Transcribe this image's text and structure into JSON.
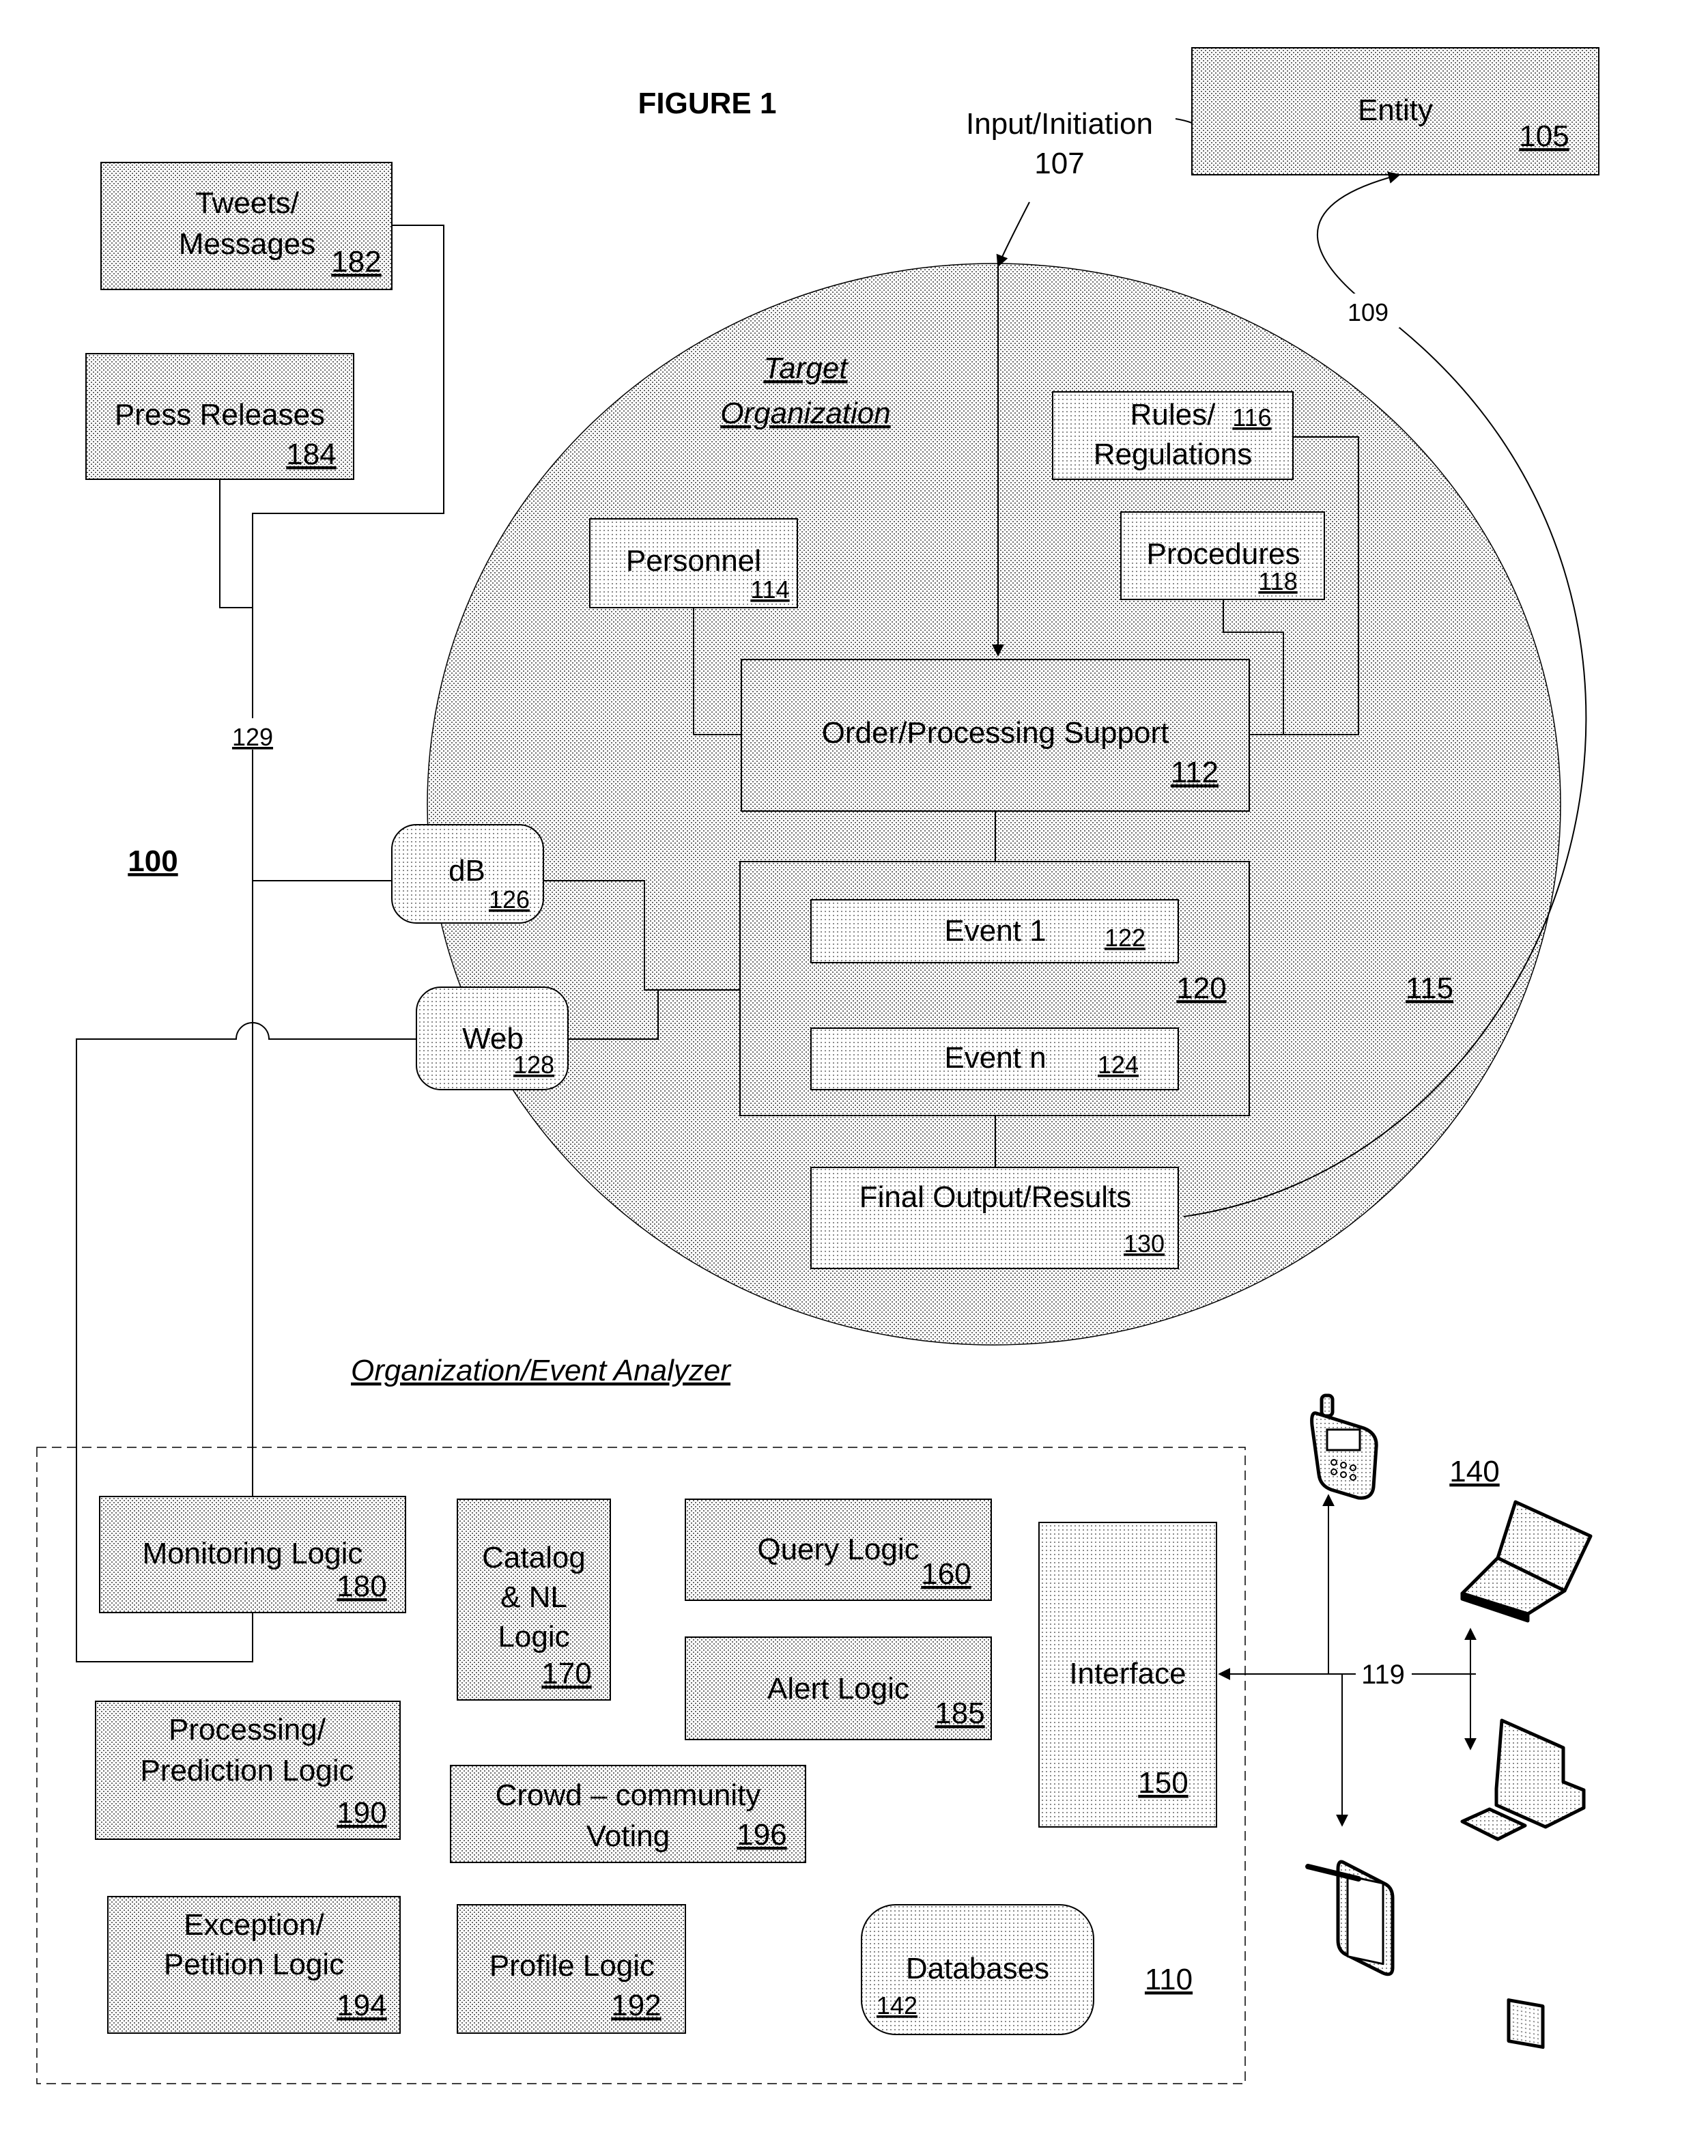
{
  "figure": {
    "title": "FIGURE 1",
    "system_ref": "100"
  },
  "entity": {
    "label": "Entity",
    "ref": "105"
  },
  "input": {
    "label": "Input/Initiation",
    "ref": "107"
  },
  "feedback": {
    "ref": "109"
  },
  "target_org": {
    "title_line1": "Target",
    "title_line2": "Organization",
    "ref": "115",
    "personnel": {
      "label": "Personnel",
      "ref": "114"
    },
    "rules": {
      "label_line1": "Rules/",
      "label_line2": "Regulations",
      "ref": "116"
    },
    "procedures": {
      "label": "Procedures",
      "ref": "118"
    },
    "order_processing": {
      "label": "Order/Processing Support",
      "ref": "112"
    },
    "events_group": {
      "ref": "120"
    },
    "event1": {
      "label": "Event 1",
      "ref": "122"
    },
    "eventn": {
      "label": "Event n",
      "ref": "124"
    },
    "final_output": {
      "label": "Final Output/Results",
      "ref": "130"
    },
    "db": {
      "label": "dB",
      "ref": "126"
    },
    "web": {
      "label": "Web",
      "ref": "128"
    }
  },
  "sources": {
    "tweets": {
      "label_line1": "Tweets/",
      "label_line2": "Messages",
      "ref": "182"
    },
    "press": {
      "label": "Press Releases",
      "ref": "184"
    },
    "bus_ref": "129"
  },
  "analyzer": {
    "title": "Organization/Event Analyzer",
    "ref": "110",
    "monitoring": {
      "label": "Monitoring Logic",
      "ref": "180"
    },
    "catalog": {
      "line1": "Catalog",
      "line2": "& NL",
      "line3": "Logic",
      "ref": "170"
    },
    "query": {
      "label": "Query Logic",
      "ref": "160"
    },
    "alert": {
      "label": "Alert Logic",
      "ref": "185"
    },
    "interface": {
      "label": "Interface",
      "ref": "150"
    },
    "processing": {
      "line1": "Processing/",
      "line2": "Prediction Logic",
      "ref": "190"
    },
    "crowd": {
      "line1": "Crowd – community",
      "line2": "Voting",
      "ref": "196"
    },
    "exception": {
      "line1": "Exception/",
      "line2": "Petition Logic",
      "ref": "194"
    },
    "profile": {
      "label": "Profile Logic",
      "ref": "192"
    },
    "databases": {
      "label": "Databases",
      "ref": "142"
    }
  },
  "devices": {
    "ref": "140",
    "link_ref": "119",
    "items": [
      "mobile-phone",
      "laptop",
      "desktop-computer",
      "tablet-with-stylus"
    ]
  }
}
